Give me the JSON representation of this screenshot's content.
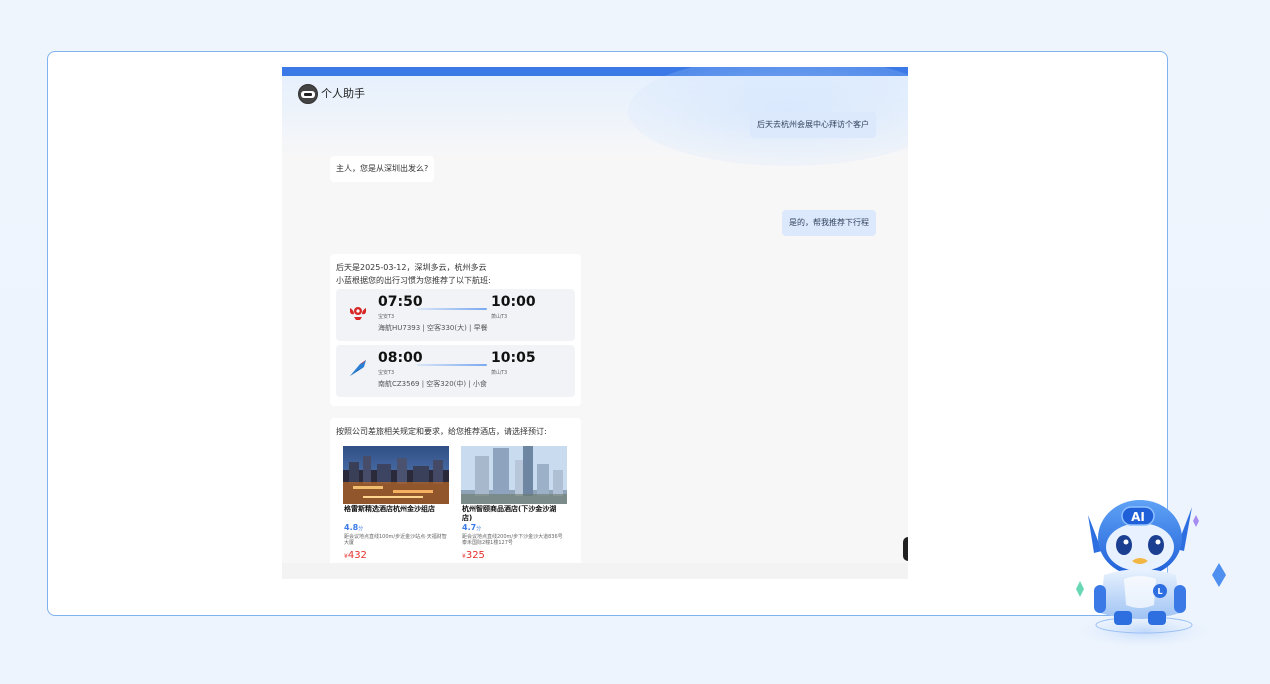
{
  "app": {
    "title": "个人助手"
  },
  "chat": {
    "user_msg_1": "后天去杭州会展中心拜访个客户",
    "bot_msg_1": "主人，您是从深圳出发么?",
    "user_msg_2": "是的，帮我推荐下行程",
    "bot_msg_2_line1": "后天是2025-03-12，深圳多云，杭州多云",
    "bot_msg_2_line2": "小蓝根据您的出行习惯为您推荐了以下航班:",
    "flights": [
      {
        "airline_icon": "hainan-airlines-logo-icon",
        "depart_time": "07:50",
        "arrive_time": "10:00",
        "depart_airport": "宝安T3",
        "arrive_airport": "萧山T3",
        "info": "海航HU7393 | 空客330(大) | 早餐"
      },
      {
        "airline_icon": "china-southern-logo-icon",
        "depart_time": "08:00",
        "arrive_time": "10:05",
        "depart_airport": "宝安T3",
        "arrive_airport": "萧山T3",
        "info": "南航CZ3569 | 空客320(中) | 小食"
      }
    ],
    "hotel_intro": "按照公司差旅相关规定和要求，给您推荐酒店，请选择预订:",
    "hotels": [
      {
        "name": "格雷斯精选酒店杭州金沙组店",
        "rating": "4.8",
        "rating_unit": "分",
        "address": "距会议地点直线100m/步近金沙站点·天福财智大厦",
        "currency": "¥",
        "price": "432"
      },
      {
        "name": "杭州智颐商品酒店(下沙金沙湖店)",
        "rating": "4.7",
        "rating_unit": "分",
        "address": "距会议地点直线200m/步下沙金沙大道836号 泰禾国际2幢1楼127号",
        "currency": "¥",
        "price": "325"
      }
    ]
  },
  "mascot": {
    "badge": "AI",
    "chest_letter": "L"
  },
  "colors": {
    "accent": "#3b7ae6",
    "user_bubble": "#dce8fc",
    "price": "#e5322d",
    "border": "#7fb2ee"
  }
}
